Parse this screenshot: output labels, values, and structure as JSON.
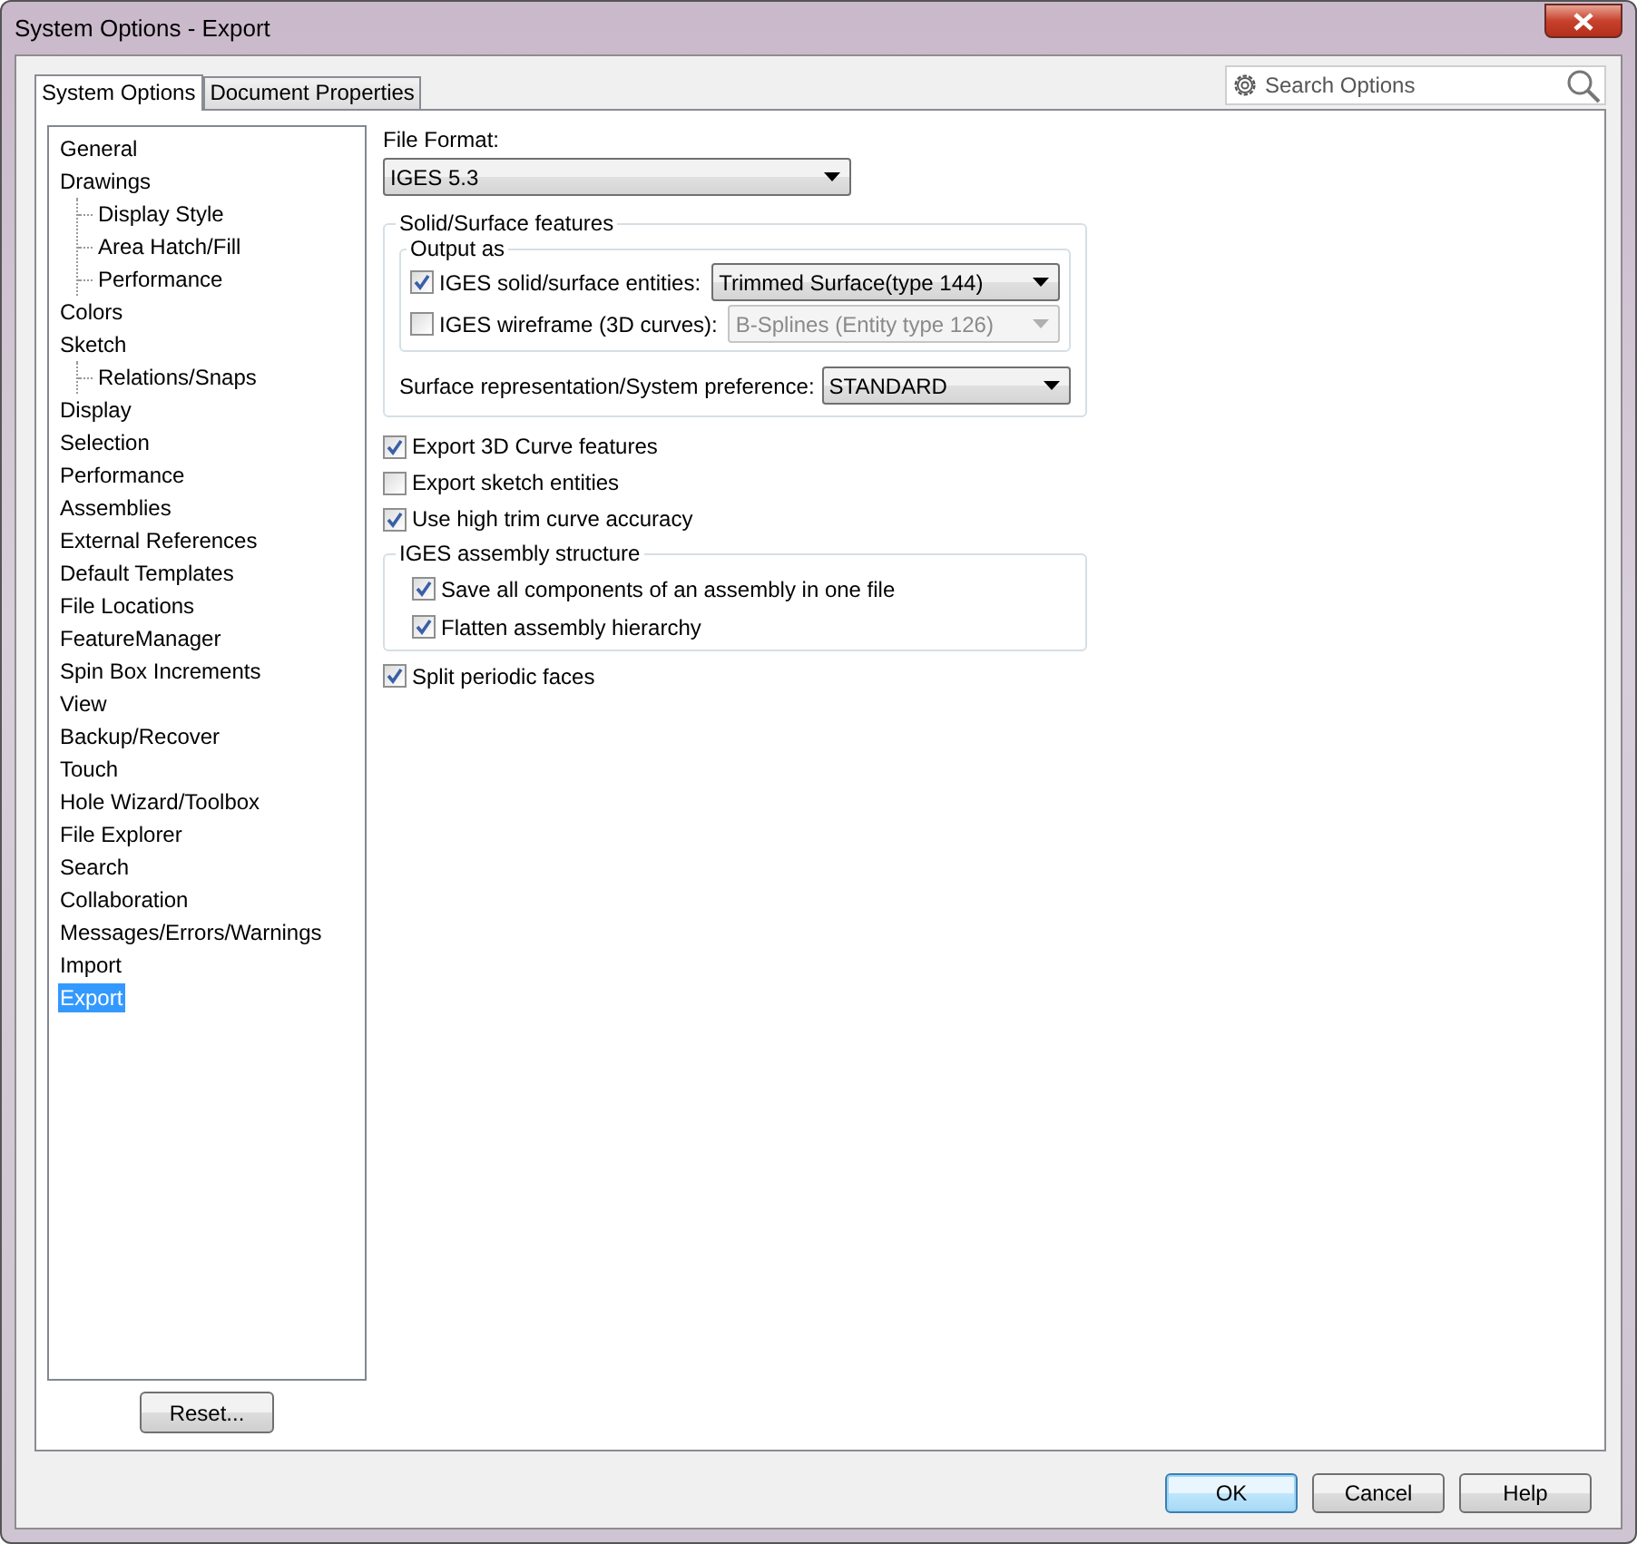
{
  "window": {
    "title": "System Options - Export"
  },
  "tabs": [
    {
      "label": "System Options",
      "selected": true
    },
    {
      "label": "Document Properties",
      "selected": false
    }
  ],
  "search": {
    "placeholder": "Search Options"
  },
  "tree": [
    {
      "label": "General",
      "selected": false
    },
    {
      "label": "Drawings",
      "selected": false,
      "children": [
        {
          "label": "Display Style",
          "selected": false
        },
        {
          "label": "Area Hatch/Fill",
          "selected": false
        },
        {
          "label": "Performance",
          "selected": false
        }
      ]
    },
    {
      "label": "Colors",
      "selected": false
    },
    {
      "label": "Sketch",
      "selected": false,
      "children": [
        {
          "label": "Relations/Snaps",
          "selected": false
        }
      ]
    },
    {
      "label": "Display",
      "selected": false
    },
    {
      "label": "Selection",
      "selected": false
    },
    {
      "label": "Performance",
      "selected": false
    },
    {
      "label": "Assemblies",
      "selected": false
    },
    {
      "label": "External References",
      "selected": false
    },
    {
      "label": "Default Templates",
      "selected": false
    },
    {
      "label": "File Locations",
      "selected": false
    },
    {
      "label": "FeatureManager",
      "selected": false
    },
    {
      "label": "Spin Box Increments",
      "selected": false
    },
    {
      "label": "View",
      "selected": false
    },
    {
      "label": "Backup/Recover",
      "selected": false
    },
    {
      "label": "Touch",
      "selected": false
    },
    {
      "label": "Hole Wizard/Toolbox",
      "selected": false
    },
    {
      "label": "File Explorer",
      "selected": false
    },
    {
      "label": "Search",
      "selected": false
    },
    {
      "label": "Collaboration",
      "selected": false
    },
    {
      "label": "Messages/Errors/Warnings",
      "selected": false
    },
    {
      "label": "Import",
      "selected": false
    },
    {
      "label": "Export",
      "selected": true
    }
  ],
  "reset_button": "Reset...",
  "file_format": {
    "label": "File Format:",
    "value": "IGES 5.3"
  },
  "solid_surface": {
    "title": "Solid/Surface features",
    "output_as": {
      "title": "Output as",
      "rows": [
        {
          "label": "IGES solid/surface entities:",
          "checked": true,
          "value": "Trimmed Surface(type 144)",
          "disabled": false
        },
        {
          "label": "IGES wireframe (3D curves):",
          "checked": false,
          "value": "B-Splines (Entity type 126)",
          "disabled": true
        }
      ]
    },
    "surface_rep": {
      "label": "Surface representation/System preference:",
      "value": "STANDARD"
    }
  },
  "options": [
    {
      "label": "Export 3D Curve features",
      "checked": true
    },
    {
      "label": "Export sketch entities",
      "checked": false
    },
    {
      "label": "Use high trim curve accuracy",
      "checked": true
    }
  ],
  "assembly": {
    "title": "IGES assembly structure",
    "options": [
      {
        "label": "Save all components of an assembly in one file",
        "checked": true
      },
      {
        "label": "Flatten assembly hierarchy",
        "checked": true
      }
    ]
  },
  "options_after": [
    {
      "label": "Split periodic faces",
      "checked": true
    }
  ],
  "buttons": [
    {
      "label": "OK",
      "default": true
    },
    {
      "label": "Cancel",
      "default": false
    },
    {
      "label": "Help",
      "default": false
    }
  ]
}
